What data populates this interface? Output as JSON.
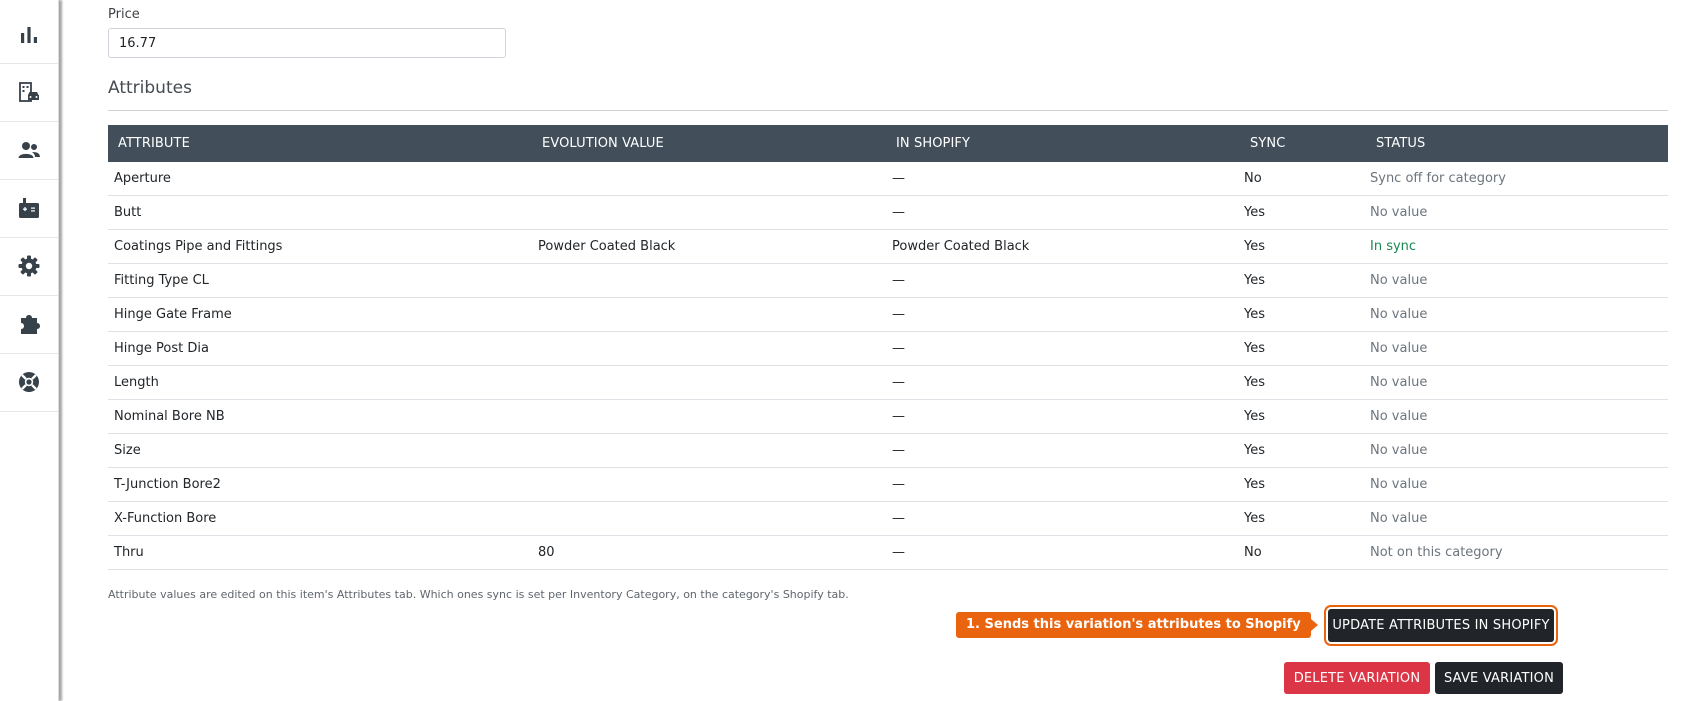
{
  "sidebar": {
    "items": [
      {
        "icon": "bar-chart-icon"
      },
      {
        "icon": "building-car-icon"
      },
      {
        "icon": "users-icon"
      },
      {
        "icon": "cash-register-icon"
      },
      {
        "icon": "gear-icon"
      },
      {
        "icon": "puzzle-piece-icon"
      },
      {
        "icon": "life-ring-icon"
      }
    ]
  },
  "form": {
    "price_label": "Price",
    "price_value": "16.77"
  },
  "attributes": {
    "title": "Attributes",
    "columns": [
      "ATTRIBUTE",
      "EVOLUTION VALUE",
      "IN SHOPIFY",
      "SYNC",
      "STATUS"
    ],
    "rows": [
      {
        "attribute": "Aperture",
        "evolution_value": "",
        "in_shopify": "—",
        "sync": "No",
        "status": "Sync off for category"
      },
      {
        "attribute": "Butt",
        "evolution_value": "",
        "in_shopify": "—",
        "sync": "Yes",
        "status": "No value"
      },
      {
        "attribute": "Coatings Pipe and Fittings",
        "evolution_value": "Powder Coated Black",
        "in_shopify": "Powder Coated Black",
        "sync": "Yes",
        "status": "In sync"
      },
      {
        "attribute": "Fitting Type CL",
        "evolution_value": "",
        "in_shopify": "—",
        "sync": "Yes",
        "status": "No value"
      },
      {
        "attribute": "Hinge Gate Frame",
        "evolution_value": "",
        "in_shopify": "—",
        "sync": "Yes",
        "status": "No value"
      },
      {
        "attribute": "Hinge Post Dia",
        "evolution_value": "",
        "in_shopify": "—",
        "sync": "Yes",
        "status": "No value"
      },
      {
        "attribute": "Length",
        "evolution_value": "",
        "in_shopify": "—",
        "sync": "Yes",
        "status": "No value"
      },
      {
        "attribute": "Nominal Bore NB",
        "evolution_value": "",
        "in_shopify": "—",
        "sync": "Yes",
        "status": "No value"
      },
      {
        "attribute": "Size",
        "evolution_value": "",
        "in_shopify": "—",
        "sync": "Yes",
        "status": "No value"
      },
      {
        "attribute": "T-Junction Bore2",
        "evolution_value": "",
        "in_shopify": "—",
        "sync": "Yes",
        "status": "No value"
      },
      {
        "attribute": "X-Function Bore",
        "evolution_value": "",
        "in_shopify": "—",
        "sync": "Yes",
        "status": "No value"
      },
      {
        "attribute": "Thru",
        "evolution_value": "80",
        "in_shopify": "—",
        "sync": "No",
        "status": "Not on this category"
      }
    ],
    "footnote": "Attribute values are edited on this item's Attributes tab. Which ones sync is set per Inventory Category, on the category's Shopify tab."
  },
  "callout": "1. Sends this variation's attributes to Shopify",
  "buttons": {
    "update": "UPDATE ATTRIBUTES IN SHOPIFY",
    "delete": "DELETE VARIATION",
    "save": "SAVE VARIATION"
  },
  "colors": {
    "header_bg": "#424f5a",
    "accent_orange": "#ea640f",
    "danger": "#dc3545",
    "success_text": "#198754",
    "dark_button": "#212529"
  }
}
